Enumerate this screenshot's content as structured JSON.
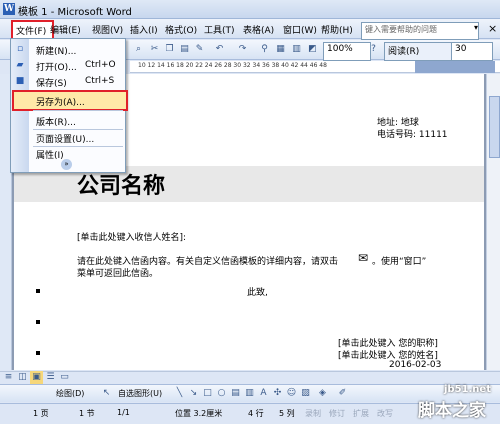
{
  "window": {
    "title": "模板 1 - Microsoft Word"
  },
  "menubar": {
    "items": [
      "文件(F)",
      "编辑(E)",
      "视图(V)",
      "插入(I)",
      "格式(O)",
      "工具(T)",
      "表格(A)",
      "窗口(W)",
      "帮助(H)"
    ],
    "help_placeholder": "键入需要帮助的问题",
    "help_arrow": "▾",
    "close_glyph": "×"
  },
  "toolbar": {
    "zoom": "100%",
    "read_label": "阅读(R)",
    "font_size": "30"
  },
  "ruler": {
    "numbers": "10   12   14   16   18   20   22   24   26   28   30   32   34   36   38   40   42   44 46 48"
  },
  "file_menu": {
    "items": [
      {
        "label": "新建(N)...",
        "shortcut": "",
        "icon": "new-icon"
      },
      {
        "label": "打开(O)...",
        "shortcut": "Ctrl+O",
        "icon": "open-icon"
      },
      {
        "label": "保存(S)",
        "shortcut": "Ctrl+S",
        "icon": "save-icon"
      },
      {
        "label": "另存为(A)...",
        "shortcut": "",
        "icon": ""
      },
      {
        "label": "版本(R)...",
        "shortcut": "",
        "icon": ""
      },
      {
        "label": "页面设置(U)...",
        "shortcut": "",
        "icon": ""
      },
      {
        "label": "属性(I)",
        "shortcut": "",
        "icon": ""
      }
    ],
    "more_glyph": "»"
  },
  "document": {
    "address": "地址: 地球",
    "phone": "电话号码: 11111",
    "company": "公司名称",
    "recipient": "[单击此处键入收信人姓名]:",
    "body_line1": "请在此处键入信函内容。有关自定义信函模板的详细内容，请双击",
    "body_line1_tail": "。使用“窗口”",
    "body_line2": "菜单可返回此信函。",
    "closing": "此致,",
    "title_field": "[单击此处键入 您的职称]",
    "name_field": "[单击此处键入 您的姓名]",
    "date": "2016-02-03"
  },
  "drawbar": {
    "draw_label": "绘图(D)",
    "autoshape_label": "自选图形(U)"
  },
  "status": {
    "page": "1 页",
    "section": "1 节",
    "page_of": "1/1",
    "position": "位置 3.2厘米",
    "line": "4 行",
    "col": "5 列",
    "rec": "录制",
    "trk": "修订",
    "ext": "扩展",
    "ovr": "改写"
  },
  "watermark": {
    "site": "jb51.net",
    "brand": "脚本之家"
  }
}
